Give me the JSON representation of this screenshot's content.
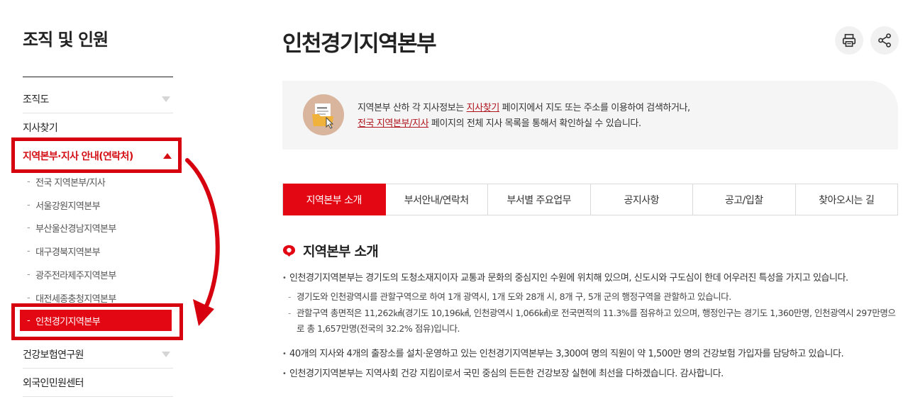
{
  "sidebar": {
    "title": "조직 및 인원",
    "items": [
      {
        "label": "조직도"
      },
      {
        "label": "지사찾기"
      },
      {
        "label": "지역본부·지사 안내(연락처)"
      }
    ],
    "sub_items": [
      {
        "label": "전국 지역본부/지사"
      },
      {
        "label": "서울강원지역본부"
      },
      {
        "label": "부산울산경남지역본부"
      },
      {
        "label": "대구경북지역본부"
      },
      {
        "label": "광주전라제주지역본부"
      },
      {
        "label": "대전세종충청지역본부"
      },
      {
        "label": "인천경기지역본부"
      }
    ],
    "bottom_items": [
      {
        "label": "건강보험연구원"
      },
      {
        "label": "외국인민원센터"
      }
    ],
    "dash": "-"
  },
  "header": {
    "title": "인천경기지역본부",
    "print_icon": "printer-icon",
    "share_icon": "share-icon"
  },
  "info": {
    "line1_before": "지역본부 산하 각 지사정보는 ",
    "link1": "지사찾기",
    "line1_after": " 페이지에서 지도 또는 주소를 이용하여 검색하거나,",
    "link2": "전국 지역본부/지사",
    "line2_after": " 페이지의 전체 지사 목록을 통해서 확인하실 수 있습니다.",
    "icon": "document-search-icon"
  },
  "tabs": [
    {
      "label": "지역본부 소개",
      "active": true
    },
    {
      "label": "부서안내/연락처"
    },
    {
      "label": "부서별 주요업무"
    },
    {
      "label": "공지사항"
    },
    {
      "label": "공고/입찰"
    },
    {
      "label": "찾아오시는 길"
    }
  ],
  "section": {
    "title": "지역본부 소개",
    "icon": "speech-bubble-icon",
    "b1": "인천경기지역본부는 경기도의 도청소재지이자 교통과 문화의 중심지인 수원에 위치해 있으며, 신도시와 구도심이 한데 어우러진 특성을 가지고 있습니다.",
    "b1_s1": "경기도와 인천광역시를 관할구역으로 하여 1개 광역시, 1개 도와 28개 시, 8개 구, 5개 군의 행정구역을 관할하고 있습니다.",
    "b1_s2": "관할구역 총면적은 11,262㎢(경기도 10,196㎢, 인천광역시 1,066㎢)로 전국면적의 11.3%를 점유하고 있으며, 행정인구는 경기도 1,360만명, 인천광역시 297만명으로 총 1,657만명(전국의 32.2% 점유)입니다.",
    "b2": "40개의 지사와 4개의 출장소를 설치·운영하고 있는 인천경기지역본부는 3,300여 명의 직원이 약 1,500만 명의 건강보험 가입자를 담당하고 있습니다.",
    "b3": "인천경기지역본부는 지역사회 건강 지킴이로서 국민 중심의 든든한 건강보장 실현에 최선을 다하겠습니다. 감사합니다."
  },
  "colors": {
    "brand_red": "#e30613",
    "highlight": "#d7000f",
    "info_bg": "#f5f5f5"
  }
}
